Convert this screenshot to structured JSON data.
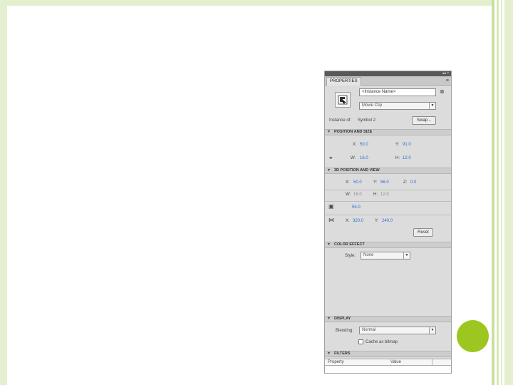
{
  "panel": {
    "tab_label": "PROPERTIES",
    "titlebar_controls": "◂◂ ×",
    "menu_icon": "≡",
    "instance_name_placeholder": "<Instance Name>",
    "symbol_type": "Movie Clip",
    "instance_of_label": "Instance of:",
    "instance_of_value": "Symbol 2",
    "swap_button": "Swap..."
  },
  "position_size": {
    "header": "POSITION AND SIZE",
    "x_label": "X:",
    "x_value": "50.0",
    "y_label": "Y:",
    "y_value": "91.0",
    "w_label": "W:",
    "w_value": "16.0",
    "h_label": "H:",
    "h_value": "12.0"
  },
  "position_view_3d": {
    "header": "3D POSITION AND VIEW",
    "x_label": "X:",
    "x_value": "50.0",
    "y_label": "Y:",
    "y_value": "56.0",
    "z_label": "Z:",
    "z_value": "0.0",
    "w_label": "W:",
    "w_value": "16.0",
    "h_label": "H:",
    "h_value": "12.0",
    "perspective_value": "55.0",
    "vp_x_label": "X:",
    "vp_x_value": "320.0",
    "vp_y_label": "Y:",
    "vp_y_value": "240.0",
    "reset_button": "Reset"
  },
  "color_effect": {
    "header": "COLOR EFFECT",
    "style_label": "Style:",
    "style_value": "None"
  },
  "display": {
    "header": "DISPLAY",
    "blending_label": "Blending:",
    "blending_value": "Normal",
    "cache_label": "Cache as bitmap"
  },
  "filters": {
    "header": "FILTERS",
    "col_property": "Property",
    "col_value": "Value"
  },
  "icons": {
    "lock": "⚭",
    "camera": "▣",
    "vanishing": "⋈",
    "collapse": "▾",
    "close": "⊗"
  },
  "colors": {
    "value_blue": "#2a6fd6",
    "accent_green": "#9dc720",
    "frame_green": "#e4efcf"
  }
}
